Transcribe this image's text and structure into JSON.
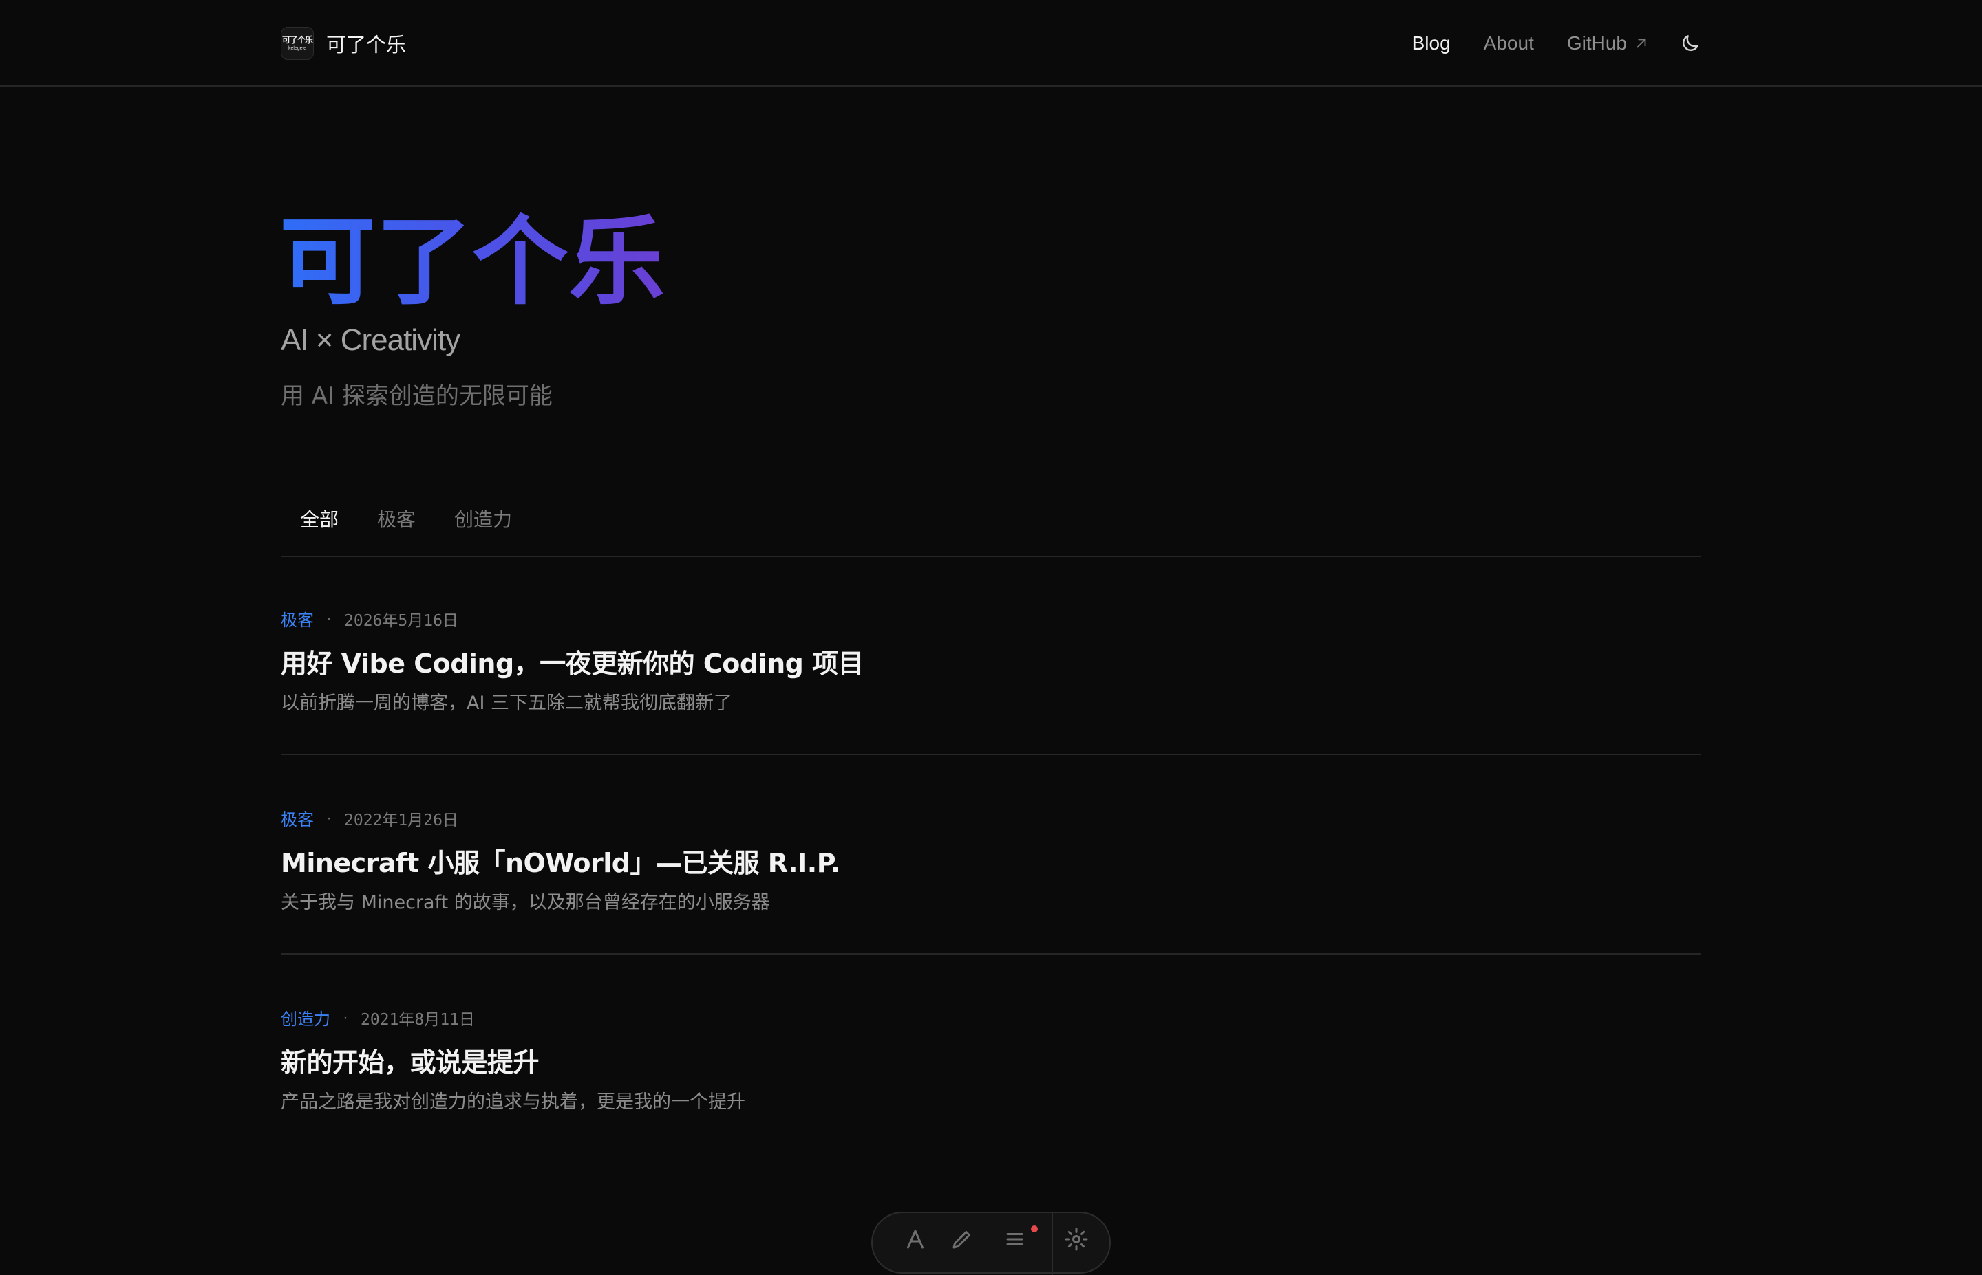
{
  "header": {
    "logo": {
      "line1": "可了个乐",
      "line2": "kelegele"
    },
    "site_name": "可了个乐",
    "nav": [
      {
        "label": "Blog",
        "active": true
      },
      {
        "label": "About",
        "active": false
      },
      {
        "label": "GitHub",
        "active": false,
        "icon": "external-arrow-icon"
      }
    ],
    "theme_toggle_icon": "moon-icon"
  },
  "hero": {
    "title": "可了个乐",
    "subtitle": "AI × Creativity",
    "description": "用 AI 探索创造的无限可能",
    "gradient": [
      "#2f6ef7",
      "#4d51e6",
      "#6a3fd3"
    ]
  },
  "tabs": [
    {
      "label": "全部",
      "active": true
    },
    {
      "label": "极客",
      "active": false
    },
    {
      "label": "创造力",
      "active": false
    }
  ],
  "posts": [
    {
      "category": "极客",
      "date": "2026年5月16日",
      "title": "用好 Vibe Coding，一夜更新你的 Coding 项目",
      "excerpt": "以前折腾一周的博客，AI 三下五除二就帮我彻底翻新了"
    },
    {
      "category": "极客",
      "date": "2022年1月26日",
      "title": "Minecraft 小服「nOWorld」—已关服 R.I.P.",
      "excerpt": "关于我与 Minecraft 的故事，以及那台曾经存在的小服务器"
    },
    {
      "category": "创造力",
      "date": "2021年8月11日",
      "title": "新的开始，或说是提升",
      "excerpt": "产品之路是我对创造力的追求与执着，更是我的一个提升"
    }
  ],
  "meta_separator": "·",
  "floating_toolbar": {
    "icons": [
      "text-a-icon",
      "pen-icon",
      "list-icon",
      "gear-icon"
    ],
    "notification_dot": true
  },
  "colors": {
    "background": "#0a0a0a",
    "accent": "#3b82f6",
    "border": "#262626",
    "text_primary": "#f2f2f2",
    "text_muted": "#8f8f8f"
  }
}
